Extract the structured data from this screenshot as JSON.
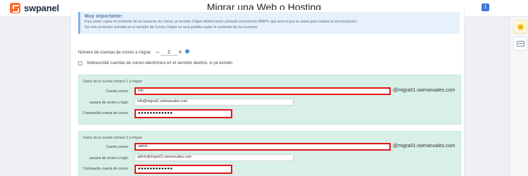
{
  "app": {
    "brand": "swpanel",
    "page_title": "Migrar una Web o Hosting",
    "badge": "1"
  },
  "notice": {
    "title": "Muy importante:",
    "line1": "Para poder copiar el contenido de los buzones de correo, el servidor Origen deberá tener activado el protocolo IMAP4, que será el que se usará para realizar la sincronización.",
    "line2": "Sin este protocolo activado en el servidor de Correo Origen no será posible copiar el contenido de los buzones."
  },
  "form": {
    "num_label": "Número de cuentas de correo a migrar",
    "minus": "−",
    "plus": "+",
    "num_value": "2",
    "subscribe_label": "Sobrescribir cuentas de correo electrónico en el servidor destino, si ya existen"
  },
  "accounts": [
    {
      "title": "Datos de la cuenta número 1 a migrar",
      "email_label": "Cuenta correo",
      "email_value": "info",
      "domain": "@migra01.swmanuales.com",
      "user_label": "usuario de correo o login",
      "user_value": "info@migra01.swmanuales.com",
      "pwd_label": "Contraseña cuenta de correo",
      "pwd_value": "●●●●●●●●●●●●"
    },
    {
      "title": "Datos de la cuenta número 2 a migrar",
      "email_label": "Cuenta correo",
      "email_value": "admin",
      "domain": "@migra01.swmanuales.com",
      "user_label": "usuario de correo o login",
      "user_value": "admin@migra01.swmanuales.com",
      "pwd_label": "Contraseña cuenta de correo",
      "pwd_value": "●●●●●●●●●●●●"
    }
  ]
}
